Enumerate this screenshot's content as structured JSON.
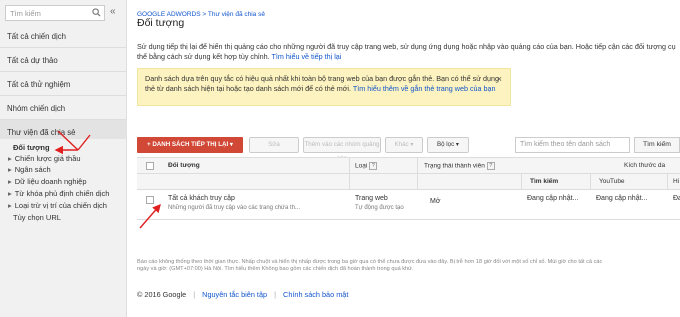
{
  "sidebar": {
    "search_placeholder": "Tìm kiếm",
    "collapse_icon": "«",
    "items": [
      {
        "label": "Tất cả chiến dịch"
      },
      {
        "label": "Tất cả dự thảo"
      },
      {
        "label": "Tất cả thử nghiệm"
      },
      {
        "label": "Nhóm chiến dịch"
      },
      {
        "label": "Thư viện đã chia sẻ"
      }
    ],
    "subitems": [
      {
        "label": "Đối tượng"
      },
      {
        "label": "Chiến lược giá thầu"
      },
      {
        "label": "Ngân sách"
      },
      {
        "label": "Dữ liệu doanh nghiệp"
      },
      {
        "label": "Từ khóa phủ định chiến dịch"
      },
      {
        "label": "Loại trừ vị trí của chiến dịch"
      },
      {
        "label": "Tùy chọn URL"
      }
    ]
  },
  "main": {
    "breadcrumb": "GOOGLE ADWORDS > Thư viện đã chia sẻ",
    "title": "Đối tượng",
    "description": "Sử dụng tiếp thị lại để hiển thị quảng cáo cho những người đã truy cập trang web, sử dụng ứng dụng hoặc nhập vào quảng cáo của bạn. Hoặc tiếp cận các đối tượng cụ thể bằng cách sử dụng kết hợp tùy chỉnh.",
    "description_link": "Tìm hiểu về tiếp thị lại",
    "notice": {
      "text": "Danh sách dựa trên quy tắc có hiệu quả nhất khi toàn bộ trang web của bạn được gắn thẻ. Bạn có thể sử dụng thẻ từ danh sách hiện tại hoặc tạo danh sách mới để có thẻ mới.",
      "link": "Tìm hiểu thêm về gắn thẻ trang web của bạn",
      "close": "×"
    },
    "toolbar": {
      "add_button": "+ DANH SÁCH TIẾP THỊ LẠI ▾",
      "edit_button": "Sửa",
      "add_to_campaign_button": "Thêm vào các nhóm quảng cáo",
      "other_button": "Khác ▾",
      "filter_button": "Bộ lọc ▾",
      "search_placeholder": "Tìm kiếm theo tên danh sách",
      "find_button": "Tìm kiếm"
    },
    "table": {
      "headers": {
        "audience": "Đối tượng",
        "type": "Loại",
        "member_status": "Trạng thái thành viên",
        "size": "Kích thước da"
      },
      "subheaders": {
        "search": "Tìm kiếm",
        "youtube": "YouTube",
        "hi": "Hi"
      },
      "rows": [
        {
          "name": "Tất cả khách truy cập",
          "subtitle": "Những người đã truy cập vào các trang chứa th...",
          "type": "Trang web",
          "type_sub": "Tự động được tạo",
          "status": "Mở",
          "search": "Đang cập nhật...",
          "youtube": "Đang cập nhật...",
          "hi": "Đa"
        }
      ]
    },
    "footnote": "Báo cáo không thống theo thời gian thực. Nhấp chuột và hiển thị nhấp được trong ba giờ qua có thể chưa được đưa vào đây. Bị trễ hơn 18 giờ đối với một số chỉ số. Múi giờ cho tất cả các ngày và giờ: (GMT+07:00) Hà Nội. Tìm hiểu thêm Không bao gồm các chiến dịch đã hoàn thành trong quá khứ.",
    "footer": {
      "copyright": "© 2016 Google",
      "editorial": "Nguyên tắc biên tập",
      "privacy": "Chính sách bảo mật"
    }
  },
  "colors": {
    "accent_red": "#d14836",
    "link_blue": "#1155cc",
    "notice_yellow": "#fdf3c0"
  }
}
